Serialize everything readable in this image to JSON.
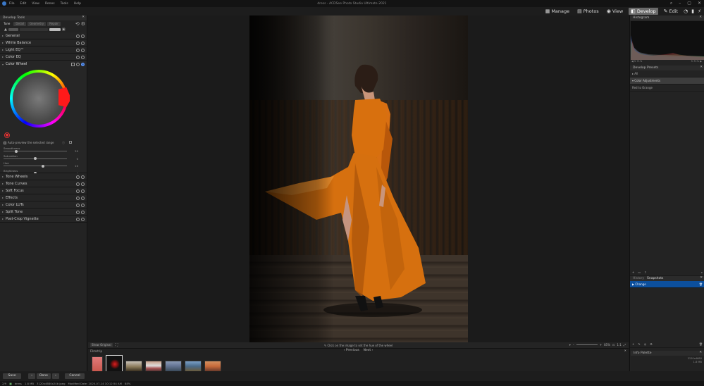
{
  "window": {
    "title": "dress - ACDSee Photo Studio Ultimate 2021"
  },
  "menu": [
    "File",
    "Edit",
    "View",
    "Renes",
    "Tools",
    "Help"
  ],
  "modes": [
    {
      "label": "Manage",
      "icon": "grid-icon",
      "active": false
    },
    {
      "label": "Photos",
      "icon": "photos-icon",
      "active": false
    },
    {
      "label": "View",
      "icon": "eye-icon",
      "active": false
    },
    {
      "label": "Develop",
      "icon": "develop-icon",
      "active": true
    },
    {
      "label": "Edit",
      "icon": "edit-icon",
      "active": false
    }
  ],
  "left_panel": {
    "title": "Develop Tools",
    "tabs": [
      "Tune",
      "Detail",
      "Geometry",
      "Repair"
    ],
    "sections_top": [
      "General",
      "White Balance",
      "Light EQ™",
      "Color EQ"
    ],
    "color_wheel": {
      "title": "Color Wheel",
      "auto_preview": "Auto-preview the selected range",
      "sliders": [
        {
          "label": "Smoothness",
          "value": "20",
          "pos": 0.2
        },
        {
          "label": "Saturation",
          "value": "0",
          "pos": 0.5
        },
        {
          "label": "Hue",
          "value": "10",
          "pos": 0.62
        },
        {
          "label": "Brightness",
          "value": "0",
          "pos": 0.5
        },
        {
          "label": "Contrast",
          "value": "0",
          "pos": 0.5
        },
        {
          "label": "Contrast Balance",
          "value": "",
          "pos": 0.5,
          "dim": true
        }
      ]
    },
    "sections_bottom": [
      "Tone Wheels",
      "Tone Curves",
      "Soft Focus",
      "Effects",
      "Color LUTs",
      "Split Tone",
      "Post-Crop Vignette"
    ]
  },
  "center": {
    "show_original": "Show Original",
    "hint": "Click on the image to set the hue of the wheel",
    "zoom": "85%"
  },
  "filmstrip": {
    "title": "Filmstrip",
    "prev": "Previous",
    "next": "Next"
  },
  "right_panel": {
    "histogram_title": "Histogram",
    "hist_left": "5.71%",
    "hist_right": "5.71%",
    "presets_title": "Develop Presets",
    "preset_items": [
      {
        "label": "All"
      },
      {
        "label": "Color Adjustments"
      },
      {
        "label": "Red to Orange"
      }
    ],
    "history_tabs": [
      "History",
      "Snapshots"
    ],
    "snapshot": "Change",
    "info_title": "Info Palette",
    "info_lines": [
      "3120x4680",
      "1.8 MB"
    ]
  },
  "buttons": {
    "save": "Save",
    "done": "Done",
    "cancel": "Cancel"
  },
  "status": [
    "2/9",
    "dress",
    "1.8 MB",
    "3120x4680x24b jpeg",
    "Modified Date: 2020-07-14 10:12:54 AM",
    "88%"
  ]
}
